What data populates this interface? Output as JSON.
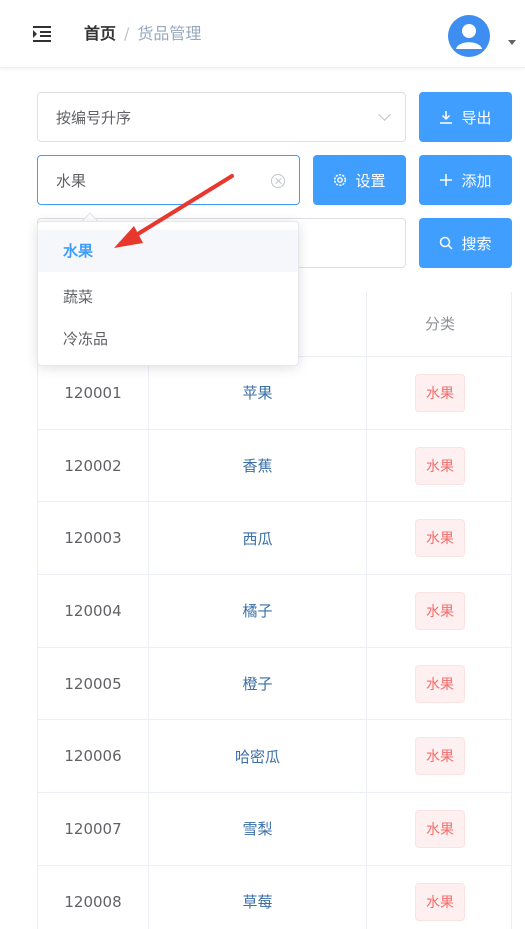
{
  "header": {
    "breadcrumb": {
      "home": "首页",
      "separator": "/",
      "current": "货品管理"
    }
  },
  "toolbar": {
    "sort_select_value": "按编号升序",
    "category_input_value": "水果",
    "search_input_value": "",
    "export_label": "导出",
    "settings_label": "设置",
    "add_label": "添加",
    "search_label": "搜索"
  },
  "dropdown": {
    "options": [
      "水果",
      "蔬菜",
      "冷冻品"
    ],
    "selected": "水果"
  },
  "table": {
    "headers": {
      "category": "分类"
    },
    "rows": [
      {
        "code": "120001",
        "name": "苹果",
        "category": "水果"
      },
      {
        "code": "120002",
        "name": "香蕉",
        "category": "水果"
      },
      {
        "code": "120003",
        "name": "西瓜",
        "category": "水果"
      },
      {
        "code": "120004",
        "name": "橘子",
        "category": "水果"
      },
      {
        "code": "120005",
        "name": "橙子",
        "category": "水果"
      },
      {
        "code": "120006",
        "name": "哈密瓜",
        "category": "水果"
      },
      {
        "code": "120007",
        "name": "雪梨",
        "category": "水果"
      },
      {
        "code": "120008",
        "name": "草莓",
        "category": "水果"
      }
    ]
  },
  "colors": {
    "primary": "#409eff",
    "tag_text": "#f56c6c",
    "tag_bg": "#fef0f0",
    "annotation_arrow": "#e8372c"
  },
  "icons": {
    "menu_toggle": "indent-menu-icon",
    "avatar": "user-avatar-icon",
    "export": "download-icon",
    "settings": "gear-icon",
    "add": "plus-icon",
    "search": "search-icon"
  }
}
